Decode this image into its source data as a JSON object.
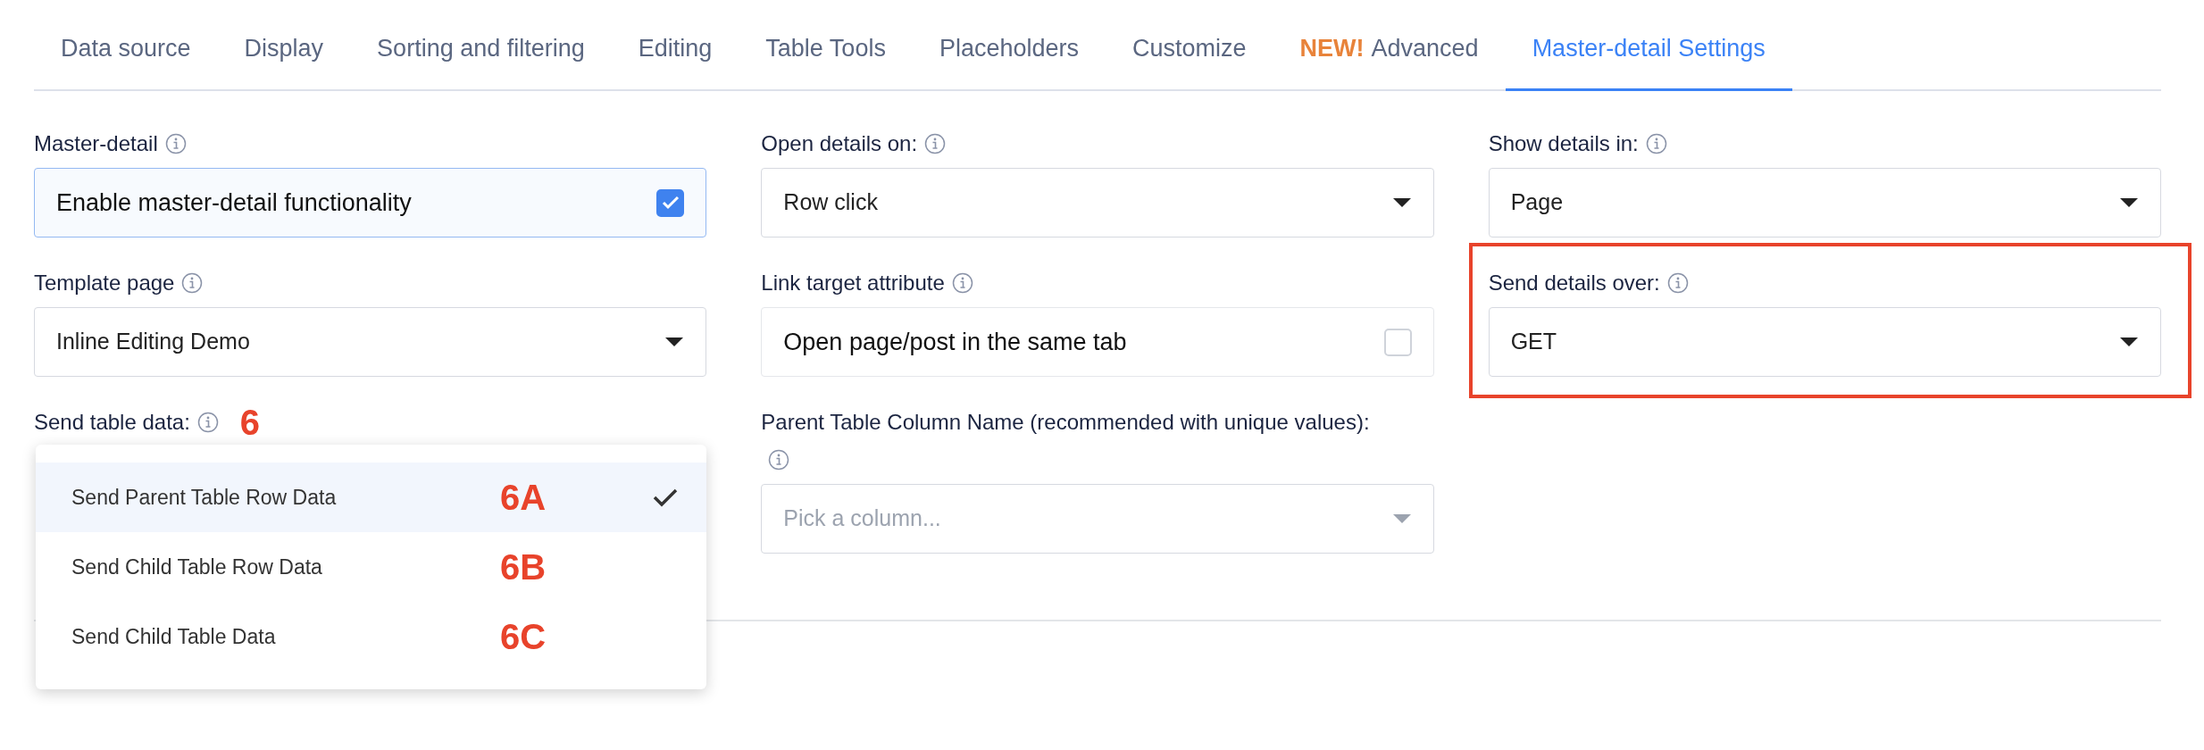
{
  "tabs": [
    {
      "label": "Data source",
      "selected": false
    },
    {
      "label": "Display",
      "selected": false
    },
    {
      "label": "Sorting and filtering",
      "selected": false
    },
    {
      "label": "Editing",
      "selected": false
    },
    {
      "label": "Table Tools",
      "selected": false
    },
    {
      "label": "Placeholders",
      "selected": false
    },
    {
      "label": "Customize",
      "selected": false
    },
    {
      "label": "Advanced",
      "badge": "NEW!",
      "selected": false
    },
    {
      "label": "Master-detail Settings",
      "selected": true
    }
  ],
  "settings": [
    {
      "kind": "checkbox",
      "label": "Master-detail",
      "value": "Enable master-detail functionality",
      "checked": true
    },
    {
      "kind": "select",
      "label": "Open details on:",
      "value": "Row click"
    },
    {
      "kind": "select",
      "label": "Show details in:",
      "value": "Page"
    },
    {
      "kind": "select",
      "label": "Template page",
      "value": "Inline Editing Demo"
    },
    {
      "kind": "checkbox",
      "label": "Link target attribute",
      "value": "Open page/post in the same tab",
      "checked": false
    },
    {
      "kind": "select",
      "label": "Send details over:",
      "value": "GET",
      "highlighted": true
    },
    {
      "kind": "menu",
      "label": "Send table data:",
      "annotation": "6",
      "options": [
        {
          "label": "Send Parent Table Row Data",
          "annotation": "6A",
          "selected": true
        },
        {
          "label": "Send Child Table Row Data",
          "annotation": "6B",
          "selected": false
        },
        {
          "label": "Send Child Table Data",
          "annotation": "6C",
          "selected": false
        }
      ]
    },
    {
      "kind": "select",
      "label": "Parent Table Column Name (recommended with unique values):",
      "placeholder": "Pick a column..."
    }
  ]
}
